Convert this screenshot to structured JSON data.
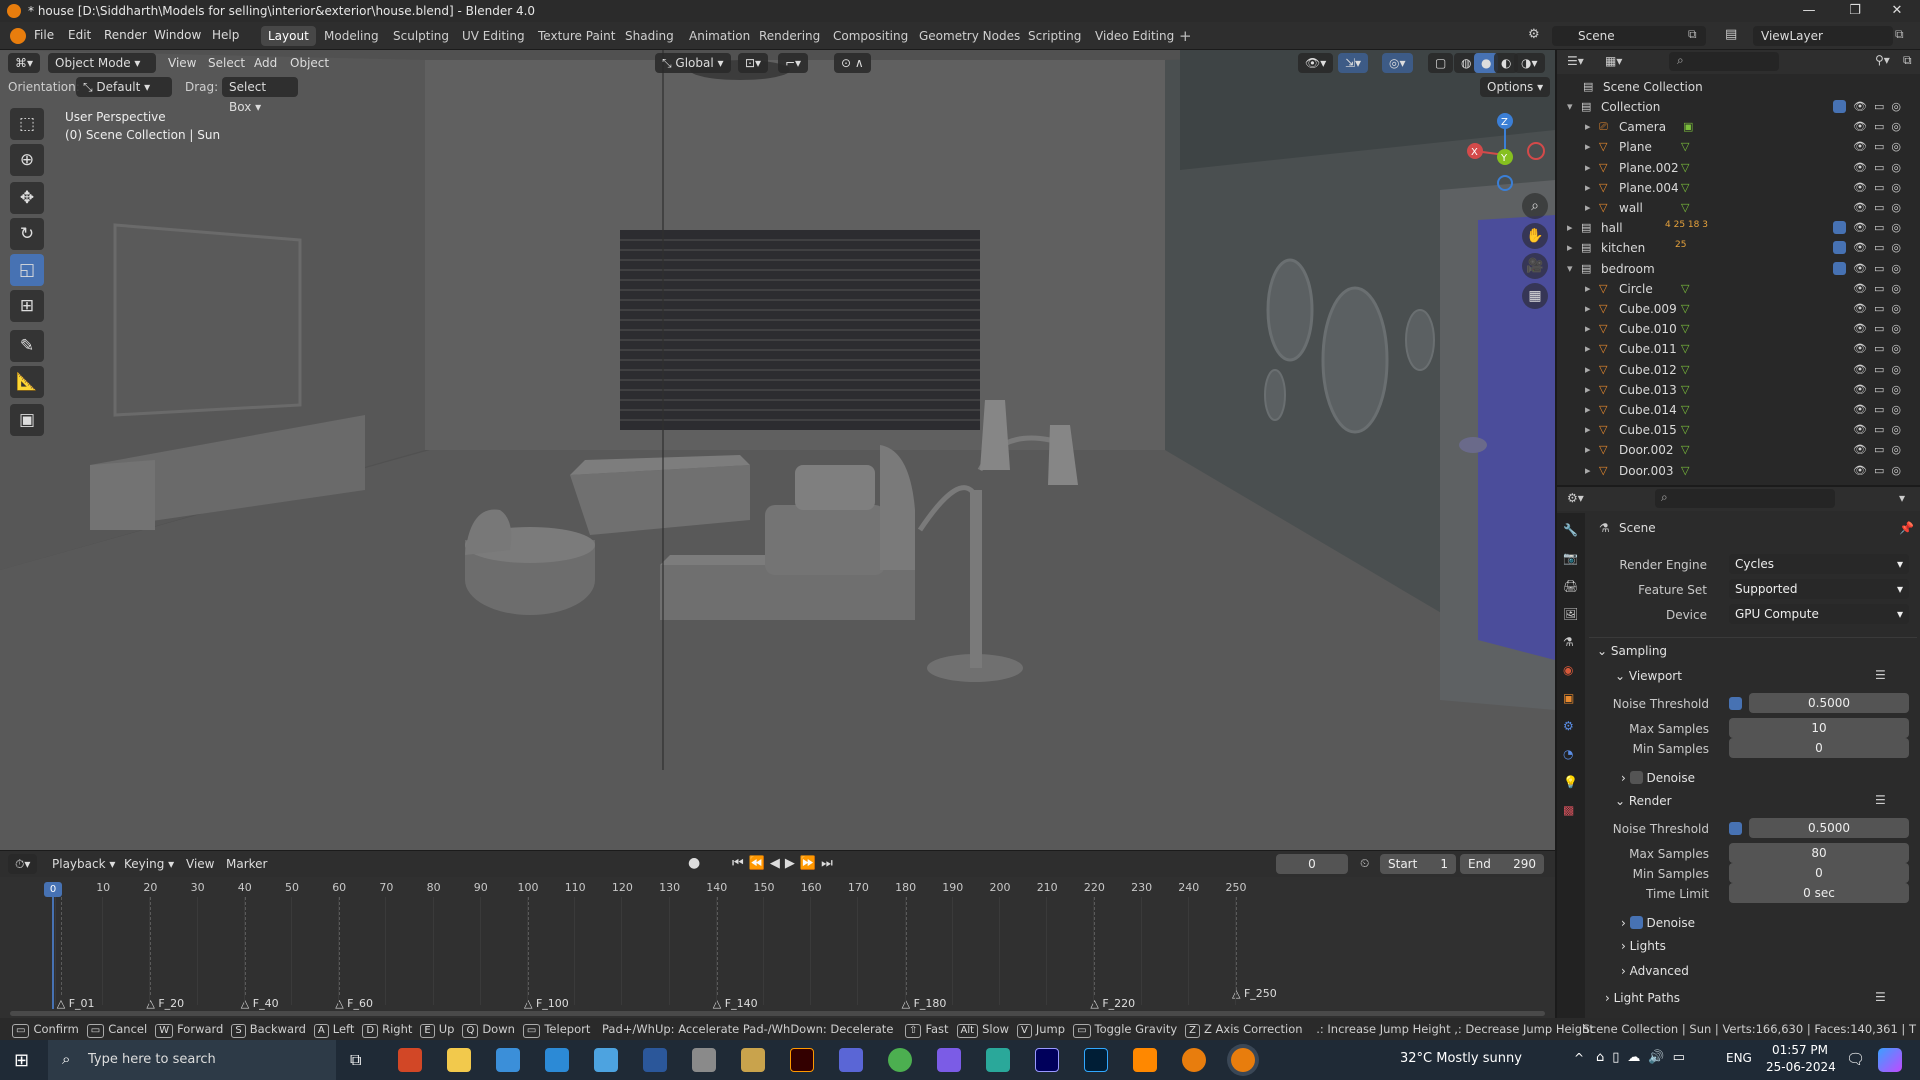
{
  "title": "* house [D:\\Siddharth\\Models for selling\\interior&exterior\\house.blend] - Blender 4.0",
  "menu": [
    "File",
    "Edit",
    "Render",
    "Window",
    "Help"
  ],
  "workspaces": [
    "Layout",
    "Modeling",
    "Sculpting",
    "UV Editing",
    "Texture Paint",
    "Shading",
    "Animation",
    "Rendering",
    "Compositing",
    "Geometry Nodes",
    "Scripting",
    "Video Editing"
  ],
  "scene_field": "Scene",
  "viewlayer_field": "ViewLayer",
  "viewport": {
    "mode": "Object Mode",
    "menus": [
      "View",
      "Select",
      "Add",
      "Object"
    ],
    "transform": "Global",
    "orientation_label": "Orientation:",
    "orientation": "Default",
    "drag_label": "Drag:",
    "drag": "Select Box",
    "options": "Options",
    "overlay_line1": "User Perspective",
    "overlay_line2": "(0) Scene Collection | Sun",
    "gizmo_x": "X",
    "gizmo_y": "Y",
    "gizmo_z": "Z"
  },
  "outliner": {
    "root": "Scene Collection",
    "rows": [
      {
        "name": "Collection",
        "icon": "collection-icon",
        "depth": 1
      },
      {
        "name": "Camera",
        "icon": "camera-icon",
        "depth": 2
      },
      {
        "name": "Plane",
        "icon": "mesh-icon",
        "depth": 2
      },
      {
        "name": "Plane.002",
        "icon": "mesh-icon",
        "depth": 2
      },
      {
        "name": "Plane.004",
        "icon": "mesh-icon",
        "depth": 2
      },
      {
        "name": "wall",
        "icon": "mesh-icon",
        "depth": 2
      },
      {
        "name": "hall",
        "icon": "collection-icon",
        "depth": 1
      },
      {
        "name": "kitchen",
        "icon": "collection-icon",
        "depth": 1
      },
      {
        "name": "bedroom",
        "icon": "collection-icon",
        "depth": 1
      },
      {
        "name": "Circle",
        "icon": "mesh-icon",
        "depth": 2
      },
      {
        "name": "Cube.009",
        "icon": "mesh-icon",
        "depth": 2
      },
      {
        "name": "Cube.010",
        "icon": "mesh-icon",
        "depth": 2
      },
      {
        "name": "Cube.011",
        "icon": "mesh-icon",
        "depth": 2
      },
      {
        "name": "Cube.012",
        "icon": "mesh-icon",
        "depth": 2
      },
      {
        "name": "Cube.013",
        "icon": "mesh-icon",
        "depth": 2
      },
      {
        "name": "Cube.014",
        "icon": "mesh-icon",
        "depth": 2
      },
      {
        "name": "Cube.015",
        "icon": "mesh-icon",
        "depth": 2
      },
      {
        "name": "Door.002",
        "icon": "mesh-icon",
        "depth": 2
      },
      {
        "name": "Door.003",
        "icon": "mesh-icon",
        "depth": 2
      }
    ],
    "hall_counts": "4  25  18  3",
    "kitchen_counts": "25"
  },
  "props": {
    "context": "Scene",
    "render_engine_label": "Render Engine",
    "render_engine": "Cycles",
    "feature_set_label": "Feature Set",
    "feature_set": "Supported",
    "device_label": "Device",
    "device": "GPU Compute",
    "sampling": "Sampling",
    "viewport": "Viewport",
    "noise_threshold_label": "Noise Threshold",
    "vp_noise": "0.5000",
    "max_samples_label": "Max Samples",
    "vp_max": "10",
    "min_samples_label": "Min Samples",
    "vp_min": "0",
    "denoise": "Denoise",
    "render": "Render",
    "r_noise": "0.5000",
    "r_max": "80",
    "r_min": "0",
    "time_limit_label": "Time Limit",
    "time_limit": "0 sec",
    "lights": "Lights",
    "advanced": "Advanced",
    "light_paths": "Light Paths"
  },
  "timeline": {
    "menus": [
      "Playback",
      "Keying",
      "View",
      "Marker"
    ],
    "current": "0",
    "start_label": "Start",
    "start": "1",
    "end_label": "End",
    "end": "290",
    "ticks": [
      "0",
      "10",
      "20",
      "30",
      "40",
      "50",
      "60",
      "70",
      "80",
      "90",
      "100",
      "110",
      "120",
      "130",
      "140",
      "150",
      "160",
      "170",
      "180",
      "190",
      "200",
      "210",
      "220",
      "230",
      "240",
      "250"
    ],
    "markers": [
      "F_01",
      "F_20",
      "F_40",
      "F_60",
      "F_100",
      "F_140",
      "F_180",
      "F_220",
      "F_250"
    ]
  },
  "status": {
    "items": [
      {
        "key": "",
        "label": "Confirm"
      },
      {
        "key": "",
        "label": "Cancel"
      },
      {
        "key": "W",
        "label": "Forward"
      },
      {
        "key": "S",
        "label": "Backward"
      },
      {
        "key": "A",
        "label": "Left"
      },
      {
        "key": "D",
        "label": "Right"
      },
      {
        "key": "E",
        "label": "Up"
      },
      {
        "key": "Q",
        "label": "Down"
      },
      {
        "key": "",
        "label": "Teleport"
      }
    ],
    "accel": "Pad+/WhUp: Accelerate Pad-/WhDown: Decelerate",
    "items2": [
      {
        "key": "⇧",
        "label": "Fast"
      },
      {
        "key": "Alt",
        "label": "Slow"
      },
      {
        "key": "V",
        "label": "Jump"
      },
      {
        "key": "",
        "label": "Toggle Gravity"
      },
      {
        "key": "Z",
        "label": "Z Axis Correction"
      }
    ],
    "jump": ".: Increase Jump Height ,: Decrease Jump Height",
    "stats": "Scene Collection | Sun | Verts:166,630 | Faces:140,361 | T"
  },
  "taskbar": {
    "search": "Type here to search",
    "weather": "32°C  Mostly sunny",
    "lang": "ENG",
    "time": "01:57 PM",
    "date": "25-06-2024"
  }
}
